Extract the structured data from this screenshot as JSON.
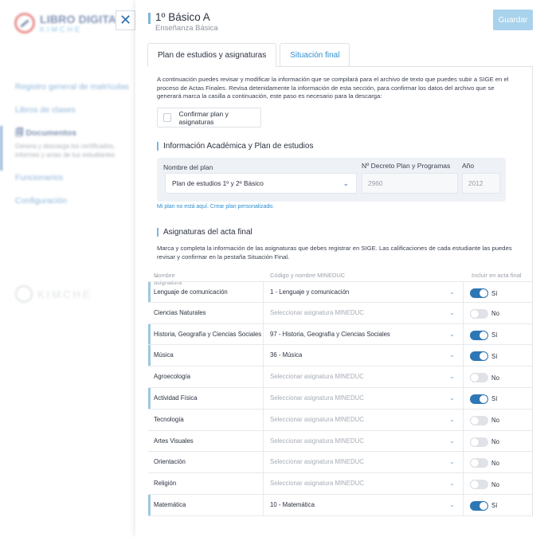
{
  "sidebar": {
    "logo_title": "LIBRO DIGITAL",
    "logo_sub": "KIMCHE",
    "items": [
      {
        "label": "Registro general de matrículas"
      },
      {
        "label": "Libros de clases"
      },
      {
        "label": "Documentos",
        "desc": "Genera y descarga los certificados, informes y actas de tus estudiantes"
      },
      {
        "label": "Funcionarios"
      },
      {
        "label": "Configuración"
      }
    ],
    "footer_brand": "KIMCHE"
  },
  "header": {
    "title": "1º Básico A",
    "subtitle": "Enseñanza Básica",
    "save_label": "Guardar",
    "close_symbol": "✕"
  },
  "tabs": [
    {
      "label": "Plan de estudios y asignaturas",
      "active": true
    },
    {
      "label": "Situación final",
      "active": false
    }
  ],
  "intro_text": "A continuación puedes revisar y modificar la información que se compilará para el archivo de texto que puedes subir a SIGE en el proceso de Actas Finales. Revisa detenidamente la información de esta sección, para confirmar los datos del archivo que se generará marca la casilla a continuación, este paso es necesario para la descarga:",
  "confirm_label": "Confirmar plan y asignaturas",
  "academic": {
    "heading": "Información Académica y Plan de estudios",
    "plan_label": "Nombre del plan",
    "plan_value": "Plan de estudios 1º y 2º Básico",
    "decree_label": "Nº Decreto Plan y Programas",
    "decree_value": "2960",
    "year_label": "Año",
    "year_value": "2012",
    "custom_link": "Mi plan no está aquí. Crear plan personalizado."
  },
  "subjects": {
    "heading": "Asignaturas del acta final",
    "intro": "Marca y completa la información de las asignaturas que debes registrar en SIGE. Las calificaciones de cada estudiante las puedes revisar y confirmar en la pestaña Situación Final.",
    "col_name": "Nombre asignatura",
    "col_code": "Código y nombre MINEDUC",
    "col_include": "Incluir en acta final",
    "rows": [
      {
        "name": "Lenguaje de comunicación",
        "code": "1 - Lenguaje y comunicación",
        "include": "Sí"
      },
      {
        "name": "Ciencias Naturales",
        "code": "Seleccionar asignatura MINEDUC",
        "include": "No"
      },
      {
        "name": "Historia, Geografía y Ciencias Sociales",
        "code": "97 - Historia, Geografía y Ciencias Sociales",
        "include": "Sí"
      },
      {
        "name": "Música",
        "code": "36 - Música",
        "include": "Sí"
      },
      {
        "name": "Agroecología",
        "code": "Seleccionar asignatura MINEDUC",
        "include": "No"
      },
      {
        "name": "Actividad Física",
        "code": "Seleccionar asignatura MINEDUC",
        "include": "Sí"
      },
      {
        "name": "Tecnología",
        "code": "Seleccionar asignatura MINEDUC",
        "include": "No"
      },
      {
        "name": "Artes Visuales",
        "code": "Seleccionar asignatura MINEDUC",
        "include": "No"
      },
      {
        "name": "Orientación",
        "code": "Seleccionar asignatura MINEDUC",
        "include": "No"
      },
      {
        "name": "Religión",
        "code": "Seleccionar asignatura MINEDUC",
        "include": "No"
      },
      {
        "name": "Matemática",
        "code": "10 - Matemática",
        "include": "Sí"
      }
    ]
  }
}
